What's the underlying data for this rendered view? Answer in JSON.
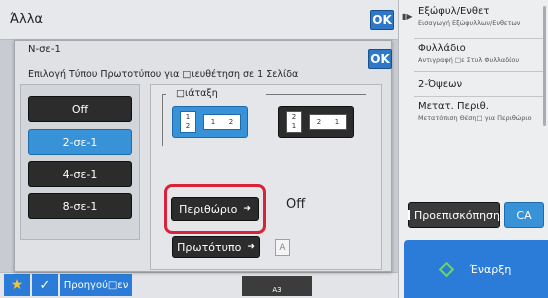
{
  "outer_title": "Άλλα",
  "ok_label": "OK",
  "dialog": {
    "title": "N-σε-1",
    "subtitle": "Επιλογή Τύπου Πρωτοτύπου για □ιευθέτηση σε 1 Σελίδα",
    "options": [
      {
        "label": "Off",
        "selected": false
      },
      {
        "label": "2-σε-1",
        "selected": true
      },
      {
        "label": "4-σε-1",
        "selected": false
      },
      {
        "label": "8-σε-1",
        "selected": false
      }
    ],
    "layout_label": "□ιάταξη",
    "layout_a_nums": [
      "1",
      "2"
    ],
    "layout_a_row": [
      "1",
      "2"
    ],
    "layout_b_nums": [
      "2",
      "1"
    ],
    "layout_b_row": [
      "2",
      "1"
    ],
    "border_button": "Περιθώριο",
    "border_value": "Off",
    "original_button": "Πρωτότυπο",
    "original_icon_letter": "A"
  },
  "right_panel": {
    "items": [
      {
        "title": "Εξώφυλ/Ενθετ",
        "sub": "Εισαγωγή Εξώφυλλων/Ενθετων"
      },
      {
        "title": "Φυλλάδιο",
        "sub": "Αντιγραφή □ε Στυλ Φυλλαδίου"
      },
      {
        "title": "2-Όψεων",
        "sub": ""
      },
      {
        "title": "Μετατ. Περιθ.",
        "sub": "Μετατόπιση Θέση□ για Περιθώριο"
      }
    ],
    "preview_label": "Προεπισκόπηση",
    "ca_label": "CA",
    "start_label": "Έναρξη"
  },
  "bottom": {
    "prev_label": "Προηγού□εν",
    "paper_label": "A3"
  },
  "colors": {
    "accent_blue": "#3892d8",
    "highlight_red": "#d9233a",
    "dark_button": "#2c2c2c"
  }
}
